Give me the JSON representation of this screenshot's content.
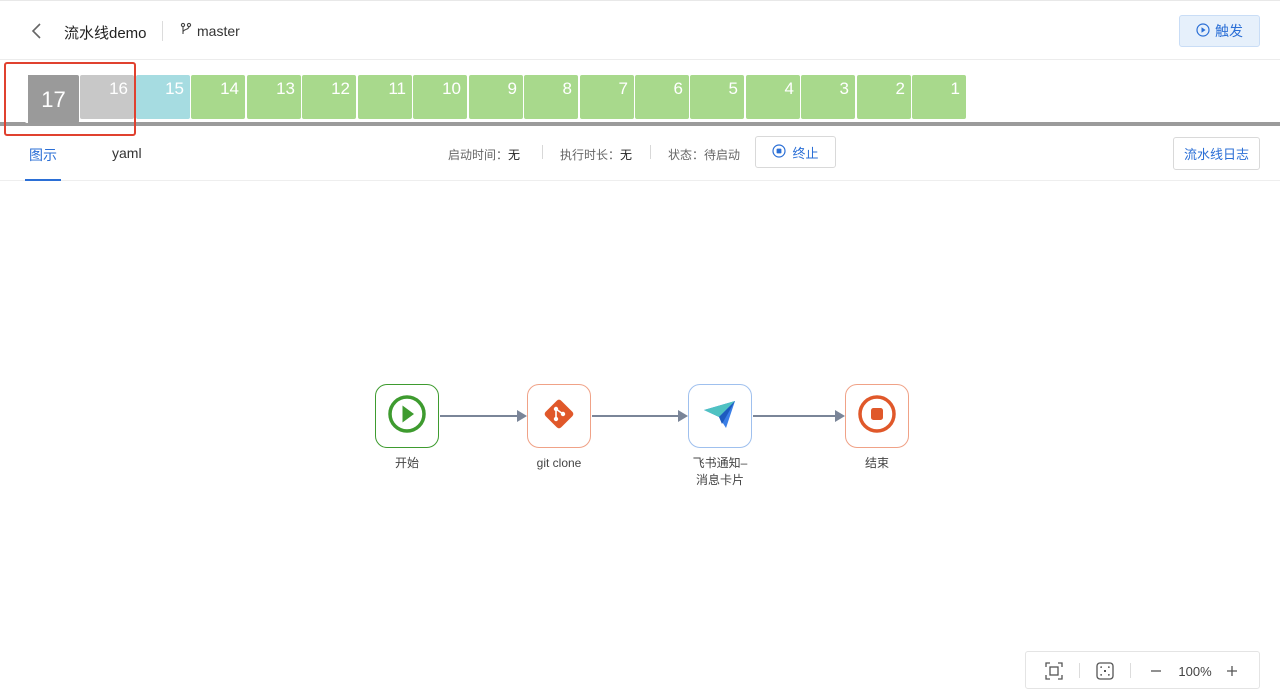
{
  "header": {
    "title": "流水线demo",
    "branch": "master",
    "trigger_label": "触发"
  },
  "runs": [
    {
      "label": "17",
      "status": "current"
    },
    {
      "label": "16",
      "status": "pending"
    },
    {
      "label": "15",
      "status": "running"
    },
    {
      "label": "14",
      "status": "success"
    },
    {
      "label": "13",
      "status": "success"
    },
    {
      "label": "12",
      "status": "success"
    },
    {
      "label": "11",
      "status": "success"
    },
    {
      "label": "10",
      "status": "success"
    },
    {
      "label": "9",
      "status": "success"
    },
    {
      "label": "8",
      "status": "success"
    },
    {
      "label": "7",
      "status": "success"
    },
    {
      "label": "6",
      "status": "success"
    },
    {
      "label": "5",
      "status": "success"
    },
    {
      "label": "4",
      "status": "success"
    },
    {
      "label": "3",
      "status": "success"
    },
    {
      "label": "2",
      "status": "success"
    },
    {
      "label": "1",
      "status": "success"
    }
  ],
  "tabs": {
    "graph": "图示",
    "yaml": "yaml"
  },
  "info": {
    "start_label": "启动时间：",
    "start_value": "无",
    "duration_label": "执行时长：",
    "duration_value": "无",
    "status_label": "状态：",
    "status_value": "待启动",
    "stop_label": "终止",
    "log_label": "流水线日志"
  },
  "pipeline": {
    "nodes": [
      {
        "name": "start",
        "label": "开始",
        "color": "#3e9b2f",
        "icon": "play-icon"
      },
      {
        "name": "git-clone",
        "label": "git clone",
        "color": "#e0582a",
        "icon": "git-icon"
      },
      {
        "name": "feishu",
        "label": "飞书通知–\n消息卡片",
        "color": "#2b6fd6",
        "icon": "paper-plane-icon"
      },
      {
        "name": "end",
        "label": "结束",
        "color": "#e0582a",
        "icon": "stop-icon"
      }
    ]
  },
  "zoom": {
    "level": "100%"
  },
  "colors": {
    "accent": "#2b6fd6",
    "success": "#a8d98c",
    "running": "#a6dce1",
    "pending": "#c8c8c8",
    "current": "#9a9a9a",
    "highlight": "#e0412f"
  }
}
